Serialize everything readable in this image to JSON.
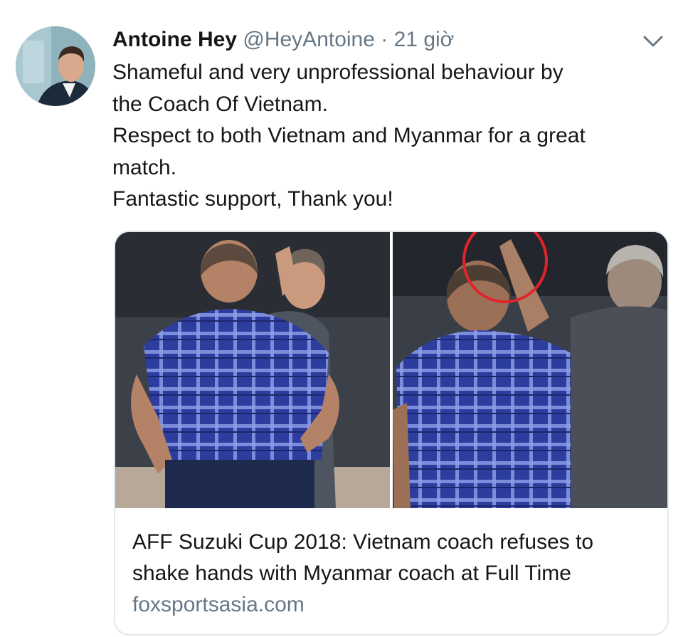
{
  "tweet": {
    "author_name": "Antoine Hey",
    "handle": "@HeyAntoine",
    "separator": "·",
    "time": "21 giờ",
    "text_lines": [
      "Shameful and very unprofessional  behaviour by",
      "the Coach Of Vietnam.",
      "Respect to both Vietnam and Myanmar for a great",
      "match.",
      "Fantastic support, Thank you!"
    ],
    "menu_icon": "chevron-down-icon"
  },
  "link_card": {
    "title_lines": [
      "AFF Suzuki Cup 2018: Vietnam coach refuses to",
      "shake hands with Myanmar coach at Full Time"
    ],
    "domain": "foxsportsasia.com",
    "annotation_color": "#e0242b"
  },
  "colors": {
    "text": "#14171a",
    "secondary": "#657786",
    "border": "#e1e8ed"
  }
}
